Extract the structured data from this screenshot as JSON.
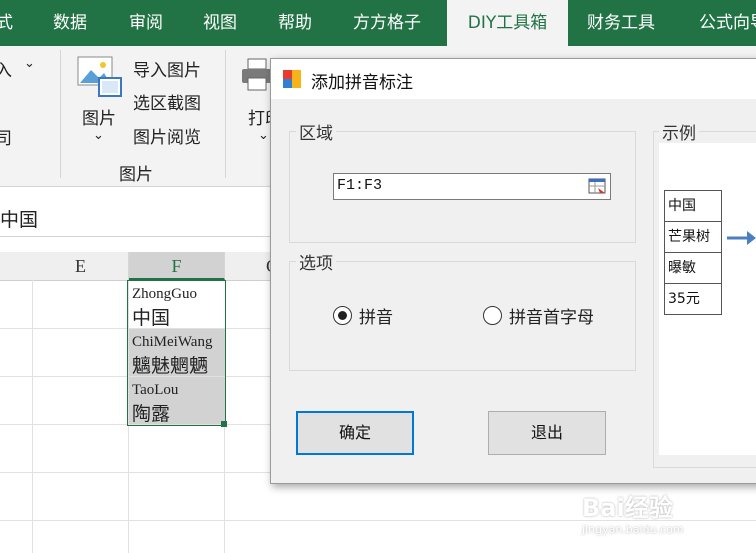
{
  "ribbon_tabs": [
    "式",
    "数据",
    "审阅",
    "视图",
    "帮助",
    "方方格子",
    "DIY工具箱",
    "财务工具",
    "公式向导"
  ],
  "ribbon": {
    "partial_top": "入",
    "partial_bottom": "司",
    "pictures_button": "图片",
    "import_pictures": "导入图片",
    "region_screenshot": "选区截图",
    "picture_view": "图片阅览",
    "group_label": "图片",
    "print_button": "打印"
  },
  "formula_bar": {
    "value": "中国"
  },
  "columns": [
    "E",
    "F",
    "G"
  ],
  "cells": [
    {
      "pinyin": "ZhongGuo",
      "hanzi": "中国"
    },
    {
      "pinyin": "ChiMeiWang",
      "hanzi": "魑魅魍魉"
    },
    {
      "pinyin": "TaoLou",
      "hanzi": "陶露"
    }
  ],
  "dialog": {
    "title": "添加拼音标注",
    "region_label": "区域",
    "region_value": "F1:F3",
    "options_label": "选项",
    "option_pinyin": "拼音",
    "option_initials": "拼音首字母",
    "selected_option": "拼音",
    "example_label": "示例",
    "example_rows": [
      "中国",
      "芒果树",
      "曝敏",
      "35元"
    ],
    "ok_button": "确定",
    "exit_button": "退出"
  },
  "watermark": {
    "main": "Bai经验",
    "sub": "jingyan.baidu.com"
  },
  "colors": {
    "ribbon_green": "#217346",
    "dialog_bg": "#f0f0f0",
    "selection_gray": "#d2d2d2",
    "focus_blue": "#0078d7"
  }
}
